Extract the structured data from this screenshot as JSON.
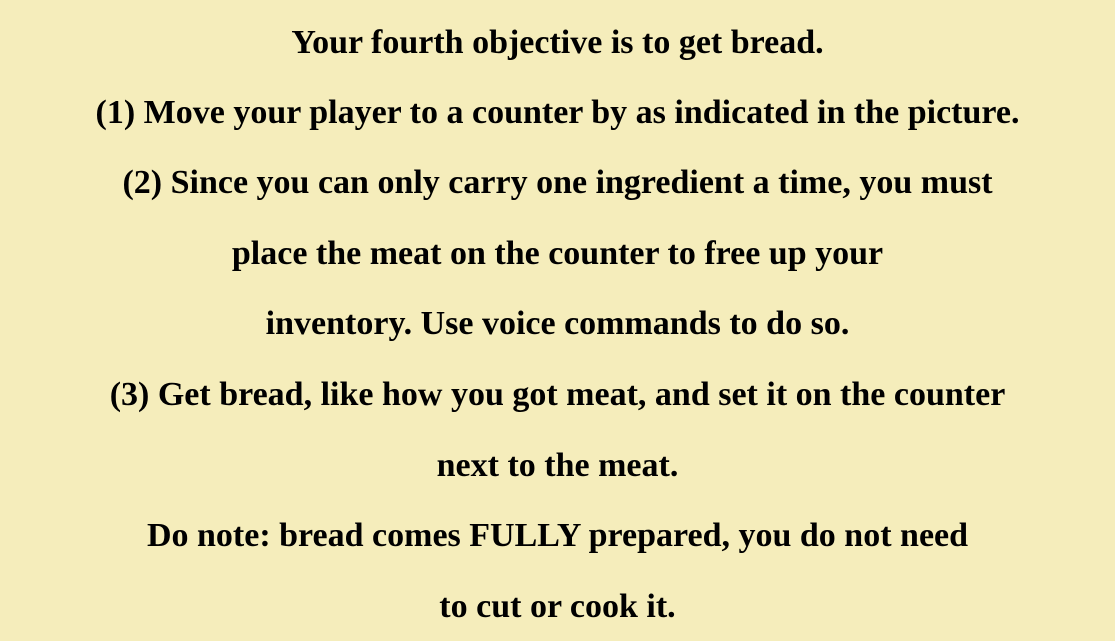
{
  "tutorial": {
    "title": "Your fourth objective is to get bread.",
    "step1": "(1) Move your player to a counter by as indicated in the picture.",
    "step2_line1": "(2) Since you can only carry one ingredient a time, you must",
    "step2_line2": "place the meat on the counter to free up your",
    "step2_line3": "inventory. Use voice commands to do so.",
    "step3_line1": "(3) Get bread, like how you got meat, and set it on the counter",
    "step3_line2": "next to the meat.",
    "note_line1": "Do note: bread comes FULLY prepared, you do not need",
    "note_line2": "to cut or cook it."
  },
  "colors": {
    "background": "#f5edbb",
    "text": "#000000"
  }
}
